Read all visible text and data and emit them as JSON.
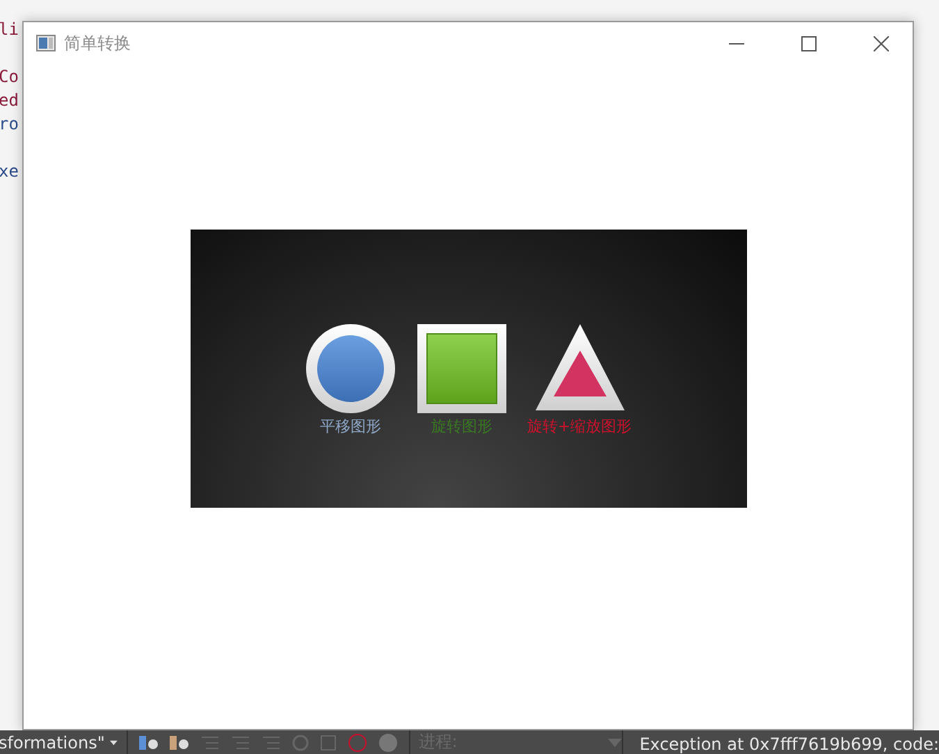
{
  "editor_fragments": [
    "li",
    "Co",
    "ed",
    "ro",
    "xe"
  ],
  "window": {
    "title": "简单转换"
  },
  "shapes": [
    {
      "kind": "circle",
      "label": "平移图形",
      "color": "#8fa8c8"
    },
    {
      "kind": "square",
      "label": "旋转图形",
      "color": "#3a7a22"
    },
    {
      "kind": "triangle",
      "label": "旋转+缩放图形",
      "color": "#d0102c"
    }
  ],
  "bottom_bar": {
    "project": "sformations\"",
    "process_label": "进程:",
    "process_disabled": true,
    "status": "Exception at 0x7fff7619b699, code:"
  }
}
